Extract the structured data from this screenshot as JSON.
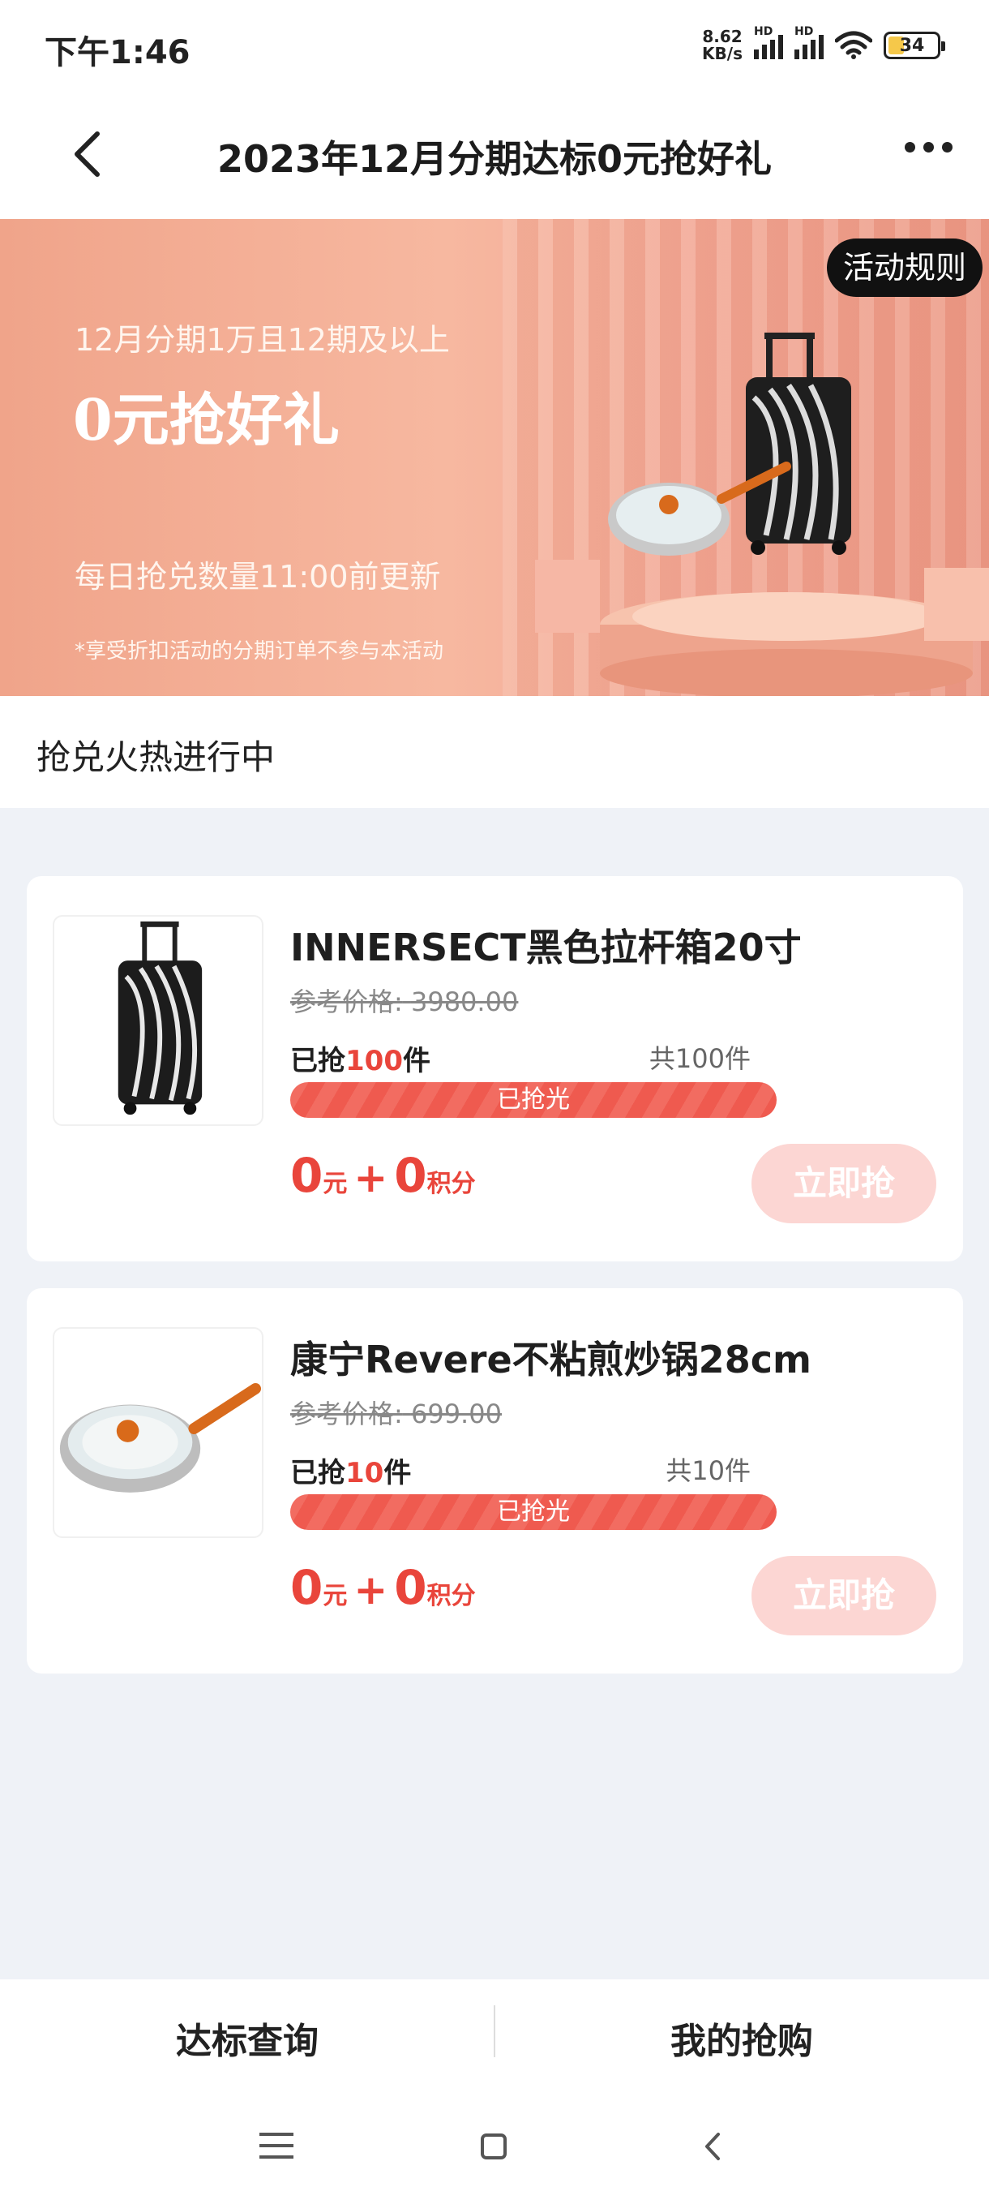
{
  "status": {
    "time": "下午1:46",
    "net_speed_value": "8.62",
    "net_speed_unit": "KB/s",
    "hd": "HD",
    "battery": "34"
  },
  "nav": {
    "title": "2023年12月分期达标0元抢好礼"
  },
  "banner": {
    "rules_button": "活动规则",
    "subtitle": "12月分期1万且12期及以上",
    "title": "0元抢好礼",
    "update_text": "每日抢兑数量11:00前更新",
    "note": "*享受折扣活动的分期订单不参与本活动"
  },
  "section": {
    "title": "抢兑火热进行中"
  },
  "products": [
    {
      "name": "INNERSECT黑色拉杆箱20寸",
      "ref_price_label": "参考价格:",
      "ref_price": "3980.00",
      "grabbed_prefix": "已抢",
      "grabbed_count": "100",
      "grabbed_suffix": "件",
      "total": "共100件",
      "progress_label": "已抢光",
      "progress": 1.0,
      "price_yuan": "0",
      "yuan_unit": "元",
      "plus": "+",
      "price_points": "0",
      "points_unit": "积分",
      "button": "立即抢",
      "image_icon": "suitcase-image"
    },
    {
      "name": "康宁Revere不粘煎炒锅28cm",
      "ref_price_label": "参考价格:",
      "ref_price": "699.00",
      "grabbed_prefix": "已抢",
      "grabbed_count": "10",
      "grabbed_suffix": "件",
      "total": "共10件",
      "progress_label": "已抢光",
      "progress": 1.0,
      "price_yuan": "0",
      "yuan_unit": "元",
      "plus": "+",
      "price_points": "0",
      "points_unit": "积分",
      "button": "立即抢",
      "image_icon": "frying-pan-image"
    }
  ],
  "bottom": {
    "left": "达标查询",
    "right": "我的抢购"
  },
  "colors": {
    "accent": "#e9453b",
    "button_disabled": "#fcd6d3",
    "banner": "#f4ae96",
    "background": "#eff2f7"
  }
}
